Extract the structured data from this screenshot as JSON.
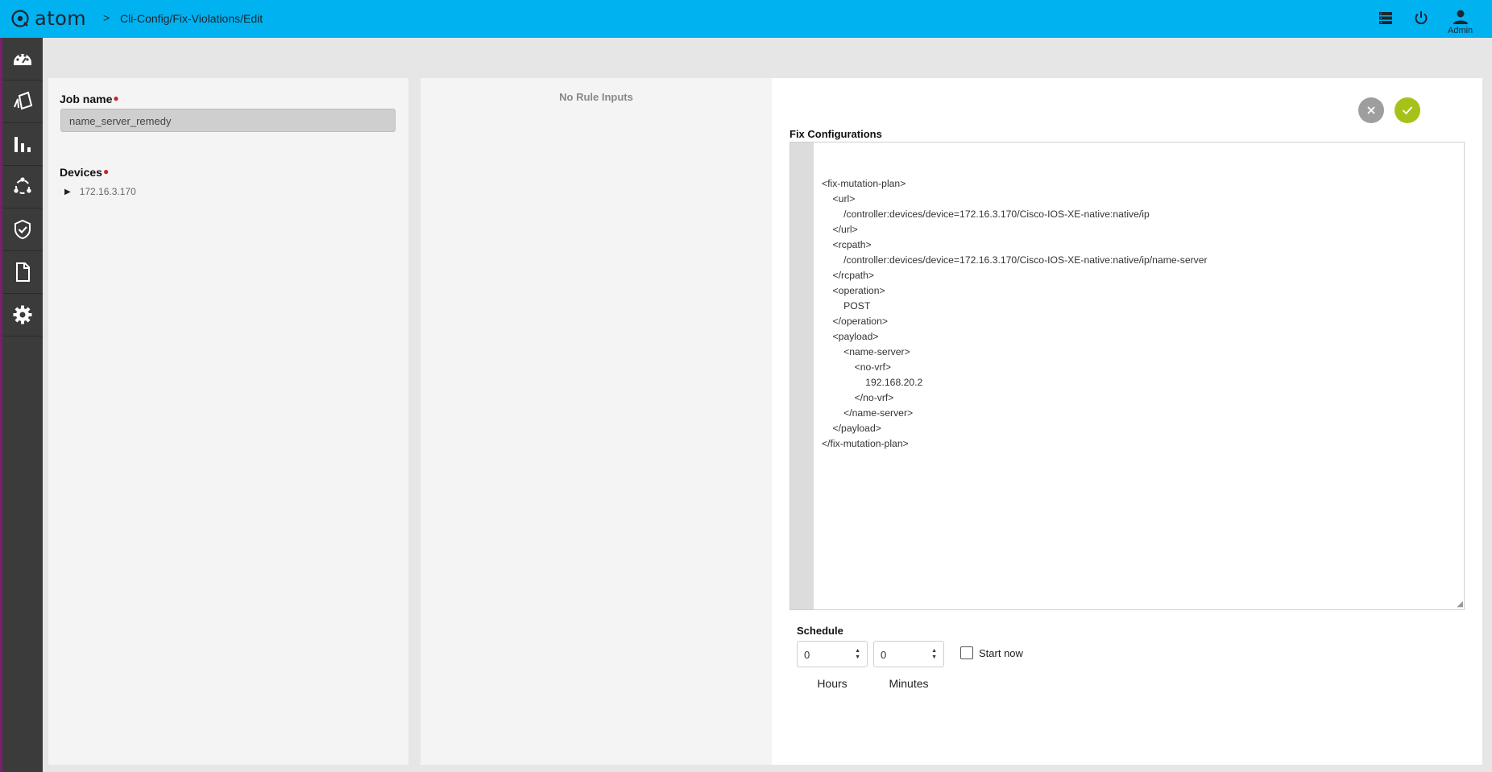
{
  "header": {
    "logo_text": "atom",
    "breadcrumb_sep": ">",
    "breadcrumb": "Cli-Config/Fix-Violations/Edit",
    "user_label": "Admin"
  },
  "sidebar": {
    "items": [
      {
        "icon": "dashboard-icon"
      },
      {
        "icon": "resource-icon"
      },
      {
        "icon": "bar-chart-icon"
      },
      {
        "icon": "topology-icon"
      },
      {
        "icon": "shield-check-icon"
      },
      {
        "icon": "document-icon"
      },
      {
        "icon": "gear-icon"
      }
    ]
  },
  "form": {
    "job_label": "Job name",
    "required_mark": "●",
    "job_value": "name_server_remedy",
    "devices_label": "Devices",
    "devices": [
      "172.16.3.170"
    ]
  },
  "rules": {
    "empty_text": "No Rule Inputs"
  },
  "fix": {
    "label": "Fix Configurations",
    "code_lines": [
      "<fix-mutation-plan>",
      "    <url>",
      "        /controller:devices/device=172.16.3.170/Cisco-IOS-XE-native:native/ip",
      "    </url>",
      "    <rcpath>",
      "        /controller:devices/device=172.16.3.170/Cisco-IOS-XE-native:native/ip/name-server",
      "    </rcpath>",
      "    <operation>",
      "        POST",
      "    </operation>",
      "    <payload>",
      "        <name-server>",
      "            <no-vrf>",
      "                192.168.20.2",
      "            </no-vrf>",
      "        </name-server>",
      "    </payload>",
      "</fix-mutation-plan>"
    ]
  },
  "schedule": {
    "label": "Schedule",
    "hours_value": "0",
    "hours_label": "Hours",
    "minutes_value": "0",
    "minutes_label": "Minutes",
    "start_now_label": "Start now",
    "start_now_checked": false
  },
  "colors": {
    "header_bg": "#00b2f0",
    "sidebar_bg": "#3b3b3b",
    "confirm": "#a6c21a",
    "cancel": "#9e9e9e",
    "required": "#c62828"
  }
}
